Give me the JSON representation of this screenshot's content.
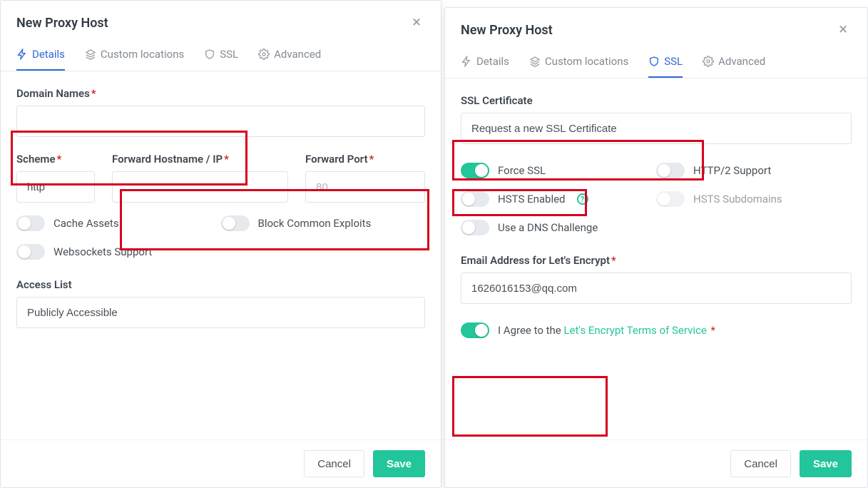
{
  "left": {
    "title": "New Proxy Host",
    "tabs": {
      "details": "Details",
      "custom": "Custom locations",
      "ssl": "SSL",
      "advanced": "Advanced"
    },
    "labels": {
      "domain": "Domain Names",
      "scheme": "Scheme",
      "fwdhost": "Forward Hostname / IP",
      "fwdport": "Forward Port",
      "cache": "Cache Assets",
      "block": "Block Common Exploits",
      "ws": "Websockets Support",
      "access": "Access List"
    },
    "values": {
      "scheme": "http",
      "port_placeholder": "80",
      "access": "Publicly Accessible"
    },
    "buttons": {
      "cancel": "Cancel",
      "save": "Save"
    }
  },
  "right": {
    "title": "New Proxy Host",
    "tabs": {
      "details": "Details",
      "custom": "Custom locations",
      "ssl": "SSL",
      "advanced": "Advanced"
    },
    "labels": {
      "sslcert": "SSL Certificate",
      "force": "Force SSL",
      "http2": "HTTP/2 Support",
      "hsts": "HSTS Enabled",
      "hsts_sub": "HSTS Subdomains",
      "dns": "Use a DNS Challenge",
      "email": "Email Address for Let's Encrypt",
      "agree_prefix": "I Agree to the ",
      "agree_link": "Let's Encrypt Terms of Service"
    },
    "values": {
      "sslcert": "Request a new SSL Certificate",
      "email": "1626016153@qq.com"
    },
    "buttons": {
      "cancel": "Cancel",
      "save": "Save"
    }
  }
}
